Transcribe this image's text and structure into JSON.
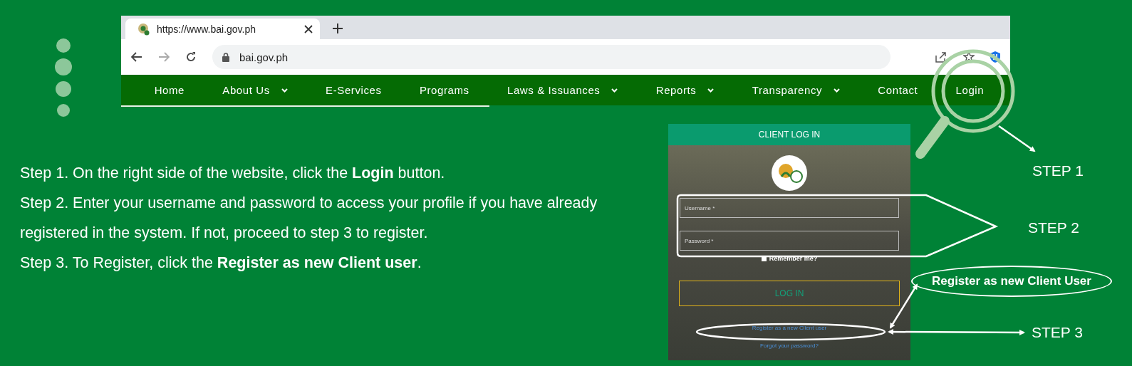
{
  "browser": {
    "tab_title": "https://www.bai.gov.ph",
    "address": "bai.gov.ph",
    "nav": [
      {
        "label": "Home",
        "dropdown": false
      },
      {
        "label": "About Us",
        "dropdown": true
      },
      {
        "label": "E-Services",
        "dropdown": false
      },
      {
        "label": "Programs",
        "dropdown": false
      },
      {
        "label": "Laws & Issuances",
        "dropdown": true
      },
      {
        "label": "Reports",
        "dropdown": true
      },
      {
        "label": "Transparency",
        "dropdown": true
      },
      {
        "label": "Contact",
        "dropdown": false
      },
      {
        "label": "Login",
        "dropdown": false
      }
    ]
  },
  "instructions": [
    "Step 1. On the right side of the website, click the **Login** button.",
    "Step 2. Enter your username and password to access your profile if you have already registered in the system. If not, proceed to step 3 to register.",
    "Step 3. To Register, click the **Register as new Client user**."
  ],
  "login_panel": {
    "title": "CLIENT LOG IN",
    "username_label": "Username *",
    "password_label": "Password *",
    "remember": {
      "label": "Remember me?",
      "checked": false
    },
    "button": "LOG IN",
    "register_link": "Register as a new Client user",
    "forgot_link": "Forgot your password?"
  },
  "annotations": {
    "step_labels": [
      "STEP 1",
      "STEP 2",
      "STEP 3"
    ],
    "callout": "Register as new Client User"
  }
}
